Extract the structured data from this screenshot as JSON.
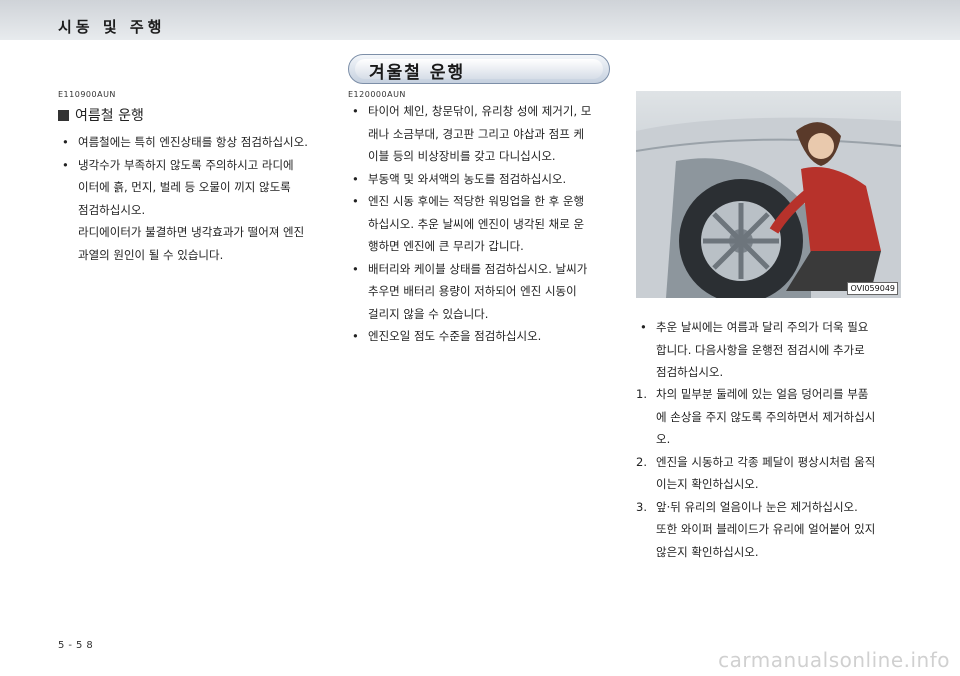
{
  "header": {
    "title": "시동 및 주행"
  },
  "section": {
    "title": "겨울철 운행"
  },
  "left": {
    "code": "E110900AUN",
    "heading": "여름철 운행",
    "bullets": [
      {
        "lines": [
          "여름철에는 특히 엔진상태를 항상 점검하십시오."
        ]
      },
      {
        "lines": [
          "냉각수가 부족하지 않도록 주의하시고 라디에",
          "이터에 흙, 먼지, 벌레 등 오물이 끼지 않도록",
          "점검하십시오.",
          "라디에이터가 불결하면 냉각효과가 떨어져 엔진",
          "과열의 원인이 될 수 있습니다."
        ]
      }
    ]
  },
  "middle": {
    "code": "E120000AUN",
    "bullets": [
      {
        "lines": [
          "타이어 체인, 창문닦이, 유리창 성에 제거기, 모",
          "래나 소금부대, 경고판 그리고 야삽과 점프 케",
          "이블 등의 비상장비를 갖고 다니십시오."
        ]
      },
      {
        "lines": [
          "부동액 및 와셔액의 농도를 점검하십시오."
        ]
      },
      {
        "lines": [
          "엔진 시동 후에는 적당한 워밍업을 한 후 운행",
          "하십시오. 추운 날씨에 엔진이 냉각된 채로 운",
          "행하면 엔진에 큰 무리가 갑니다."
        ]
      },
      {
        "lines": [
          "배터리와 케이블 상태를 점검하십시오. 날씨가",
          "추우면 배터리 용량이 저하되어 엔진 시동이",
          "걸리지 않을 수 있습니다."
        ]
      },
      {
        "lines": [
          "엔진오일 점도 수준을 점검하십시오."
        ]
      }
    ]
  },
  "right": {
    "image_label": "OVI059049",
    "bullet": {
      "lines": [
        "추운 날씨에는 여름과 달리 주의가 더욱 필요",
        "합니다. 다음사항을 운행전 점검시에 추가로",
        "점검하십시오."
      ]
    },
    "numbered": [
      {
        "num": "1.",
        "lines": [
          "차의 밑부분 둘레에 있는 얼음 덩어리를 부품",
          "에 손상을 주지 않도록 주의하면서 제거하십시",
          "오."
        ]
      },
      {
        "num": "2.",
        "lines": [
          "엔진을 시동하고 각종 페달이 평상시처럼 움직",
          "이는지 확인하십시오."
        ]
      },
      {
        "num": "3.",
        "lines": [
          "앞·뒤 유리의 얼음이나 눈은 제거하십시오.",
          "또한 와이퍼 블레이드가 유리에 얼어붙어 있지",
          "않은지 확인하십시오."
        ]
      }
    ]
  },
  "footer": {
    "page_number": "5-58",
    "watermark": "carmanualsonline.info"
  },
  "colors": {
    "header_bg": "#d4d8dc",
    "pill_border": "#7d8fa8",
    "bullet": "#222222"
  }
}
